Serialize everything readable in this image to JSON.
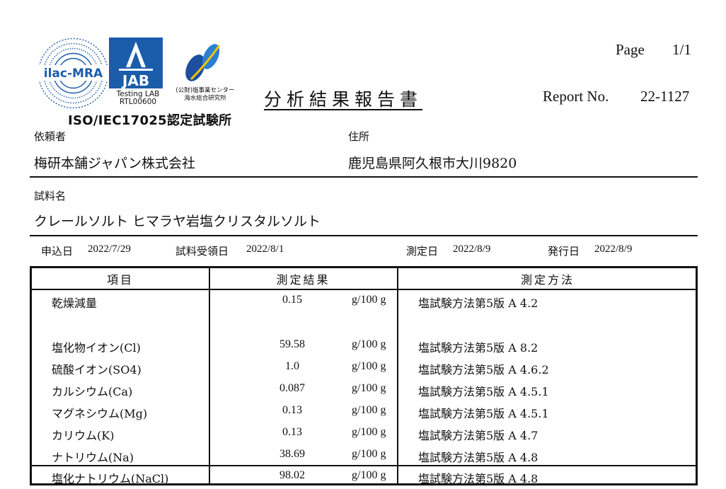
{
  "logos": {
    "ilac_text": "ilac-MRA",
    "jab_text": "JAB",
    "jab_sub1": "Testing LAB",
    "jab_sub2": "RTL00600",
    "swr_sub1": "(公財)塩事業センター",
    "swr_sub2": "海水総合研究所",
    "iso_caption": "ISO/IEC17025認定試験所"
  },
  "header": {
    "title": "分析結果報告書",
    "page_label": "Page",
    "page_value": "1/1",
    "report_label": "Report No.",
    "report_value": "22-1127"
  },
  "client": {
    "client_label": "依頼者",
    "client_value": "梅研本舗ジャパン株式会社",
    "address_label": "住所",
    "address_value": "鹿児島県阿久根市大川9820"
  },
  "sample": {
    "label": "試料名",
    "value": "クレールソルト ヒマラヤ岩塩クリスタルソルト"
  },
  "dates": {
    "apply_label": "申込日",
    "apply_value": "2022/7/29",
    "receive_label": "試料受領日",
    "receive_value": "2022/8/1",
    "measure_label": "測定日",
    "measure_value": "2022/8/9",
    "issue_label": "発行日",
    "issue_value": "2022/8/9"
  },
  "table": {
    "headers": [
      "項目",
      "測定結果",
      "測定方法"
    ],
    "rows": [
      {
        "item": "乾燥減量",
        "value": "0.15",
        "unit": "g/100 g",
        "method": "塩試験方法第5版 A 4.2"
      },
      {
        "item": "塩化物イオン(Cl)",
        "value": "59.58",
        "unit": "g/100 g",
        "method": "塩試験方法第5版 A 8.2"
      },
      {
        "item": "硫酸イオン(SO4)",
        "value": "1.0",
        "unit": "g/100 g",
        "method": "塩試験方法第5版 A 4.6.2"
      },
      {
        "item": "カルシウム(Ca)",
        "value": "0.087",
        "unit": "g/100 g",
        "method": "塩試験方法第5版 A 4.5.1"
      },
      {
        "item": "マグネシウム(Mg)",
        "value": "0.13",
        "unit": "g/100 g",
        "method": "塩試験方法第5版 A 4.5.1"
      },
      {
        "item": "カリウム(K)",
        "value": "0.13",
        "unit": "g/100 g",
        "method": "塩試験方法第5版 A 4.7"
      },
      {
        "item": "ナトリウム(Na)",
        "value": "38.69",
        "unit": "g/100 g",
        "method": "塩試験方法第5版 A 4.8"
      },
      {
        "item": "塩化ナトリウム(NaCl)",
        "value": "98.02",
        "unit": "g/100 g",
        "method": "塩試験方法第5版 A 4.8"
      }
    ]
  },
  "colors": {
    "brand_blue": "#1b5cab"
  }
}
